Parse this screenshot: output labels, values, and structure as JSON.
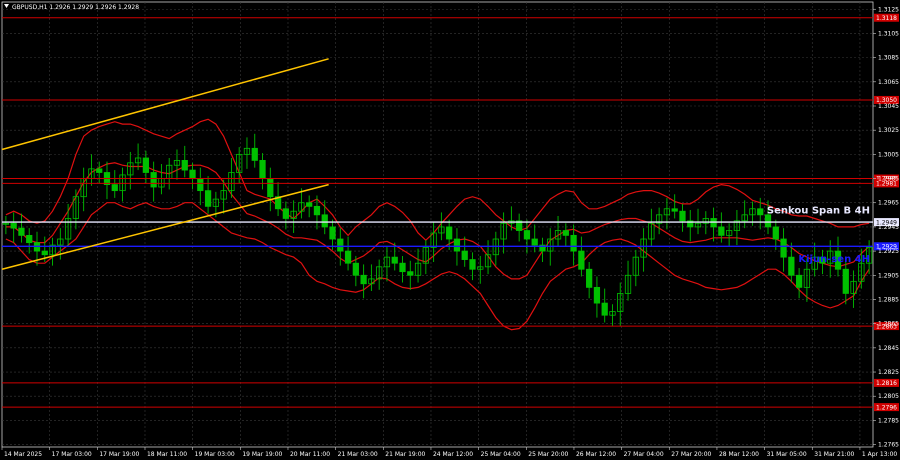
{
  "header": {
    "symbol_info": "GBPUSD,H1  1.2926 1.2929 1.2926 1.2928"
  },
  "colors": {
    "background": "#000000",
    "grid": "#3a3a3a",
    "candle": "#00c000",
    "level_red": "#d10000",
    "senkou": "#e8e8ff",
    "kijun": "#1a1aff",
    "channel": "#ffc400",
    "ichimoku": "#e01010"
  },
  "chart_data": {
    "type": "line",
    "title": "",
    "symbol": "GBPUSD",
    "timeframe": "H1",
    "ylim": [
      1.2763,
      1.3131
    ],
    "y_ticks": [
      "1.3125",
      "1.3105",
      "1.3085",
      "1.3065",
      "1.3045",
      "1.3025",
      "1.3005",
      "1.2985",
      "1.2965",
      "1.2945",
      "1.2925",
      "1.2905",
      "1.2885",
      "1.2865",
      "1.2845",
      "1.2825",
      "1.2805",
      "1.2785",
      "1.2765"
    ],
    "x_ticks": [
      "14 Mar 2025",
      "17 Mar 03:00",
      "17 Mar 19:00",
      "18 Mar 11:00",
      "19 Mar 03:00",
      "19 Mar 19:00",
      "20 Mar 11:00",
      "21 Mar 03:00",
      "21 Mar 19:00",
      "24 Mar 12:00",
      "25 Mar 04:00",
      "25 Mar 20:00",
      "26 Mar 12:00",
      "27 Mar 04:00",
      "27 Mar 20:00",
      "28 Mar 12:00",
      "31 Mar 05:00",
      "31 Mar 21:00",
      "1 Apr 13:00"
    ],
    "levels": [
      {
        "value": 1.3118,
        "label": "1.3118",
        "kind": "red"
      },
      {
        "value": 1.305,
        "label": "1.3050",
        "kind": "red"
      },
      {
        "value": 1.2985,
        "label": "1.2985",
        "kind": "red"
      },
      {
        "value": 1.2981,
        "label": "1.2981",
        "kind": "red"
      },
      {
        "value": 1.2949,
        "label": "1.2949",
        "kind": "senkou"
      },
      {
        "value": 1.2929,
        "label": "1.2929",
        "kind": "kijun"
      },
      {
        "value": 1.2863,
        "label": "1.2863",
        "kind": "red"
      },
      {
        "value": 1.2816,
        "label": "1.2816",
        "kind": "red"
      },
      {
        "value": 1.2796,
        "label": "1.2796",
        "kind": "red"
      }
    ],
    "annotations": [
      {
        "text": "Senkou Span B 4H",
        "value": 1.2956,
        "color": "#e8e8ff"
      },
      {
        "text": "Kijun-sen 4H",
        "value": 1.2916,
        "color": "#1a1aff"
      }
    ],
    "channel_lines": [
      {
        "x0": 0,
        "y0": 1.3009,
        "x1": 0.375,
        "y1": 1.3084
      },
      {
        "x0": 0,
        "y0": 1.291,
        "x1": 0.375,
        "y1": 1.298
      }
    ],
    "price": [
      1.2948,
      1.2944,
      1.2938,
      1.2932,
      1.2925,
      1.2922,
      1.293,
      1.2935,
      1.2952,
      1.297,
      1.2985,
      1.2993,
      1.299,
      1.298,
      1.2975,
      1.2988,
      1.2998,
      1.3002,
      1.299,
      1.2978,
      1.2985,
      1.2996,
      1.3,
      1.2992,
      1.2985,
      1.2975,
      1.2962,
      1.2968,
      1.2975,
      1.299,
      1.3005,
      1.301,
      1.3,
      1.2985,
      1.297,
      1.296,
      1.2952,
      1.2958,
      1.2965,
      1.2962,
      1.2955,
      1.2945,
      1.2935,
      1.2925,
      1.2915,
      1.2905,
      1.2898,
      1.2902,
      1.2912,
      1.292,
      1.2915,
      1.2908,
      1.2905,
      1.2915,
      1.2928,
      1.294,
      1.2945,
      1.2935,
      1.2925,
      1.2918,
      1.291,
      1.2912,
      1.2922,
      1.2935,
      1.2948,
      1.295,
      1.2942,
      1.2935,
      1.293,
      1.2925,
      1.2935,
      1.2942,
      1.2938,
      1.2925,
      1.291,
      1.2895,
      1.2882,
      1.2872,
      1.2875,
      1.289,
      1.2905,
      1.292,
      1.2935,
      1.2948,
      1.2955,
      1.296,
      1.2958,
      1.295,
      1.2945,
      1.2948,
      1.2952,
      1.2945,
      1.2938,
      1.2942,
      1.295,
      1.2955,
      1.296,
      1.2955,
      1.2945,
      1.2935,
      1.292,
      1.2905,
      1.2895,
      1.291,
      1.292,
      1.2915,
      1.2925,
      1.291,
      1.289,
      1.29,
      1.2915,
      1.2928
    ],
    "ichimoku_upper": [
      1.2955,
      1.2958,
      1.2955,
      1.295,
      1.2948,
      1.295,
      1.2958,
      1.297,
      1.2985,
      1.3005,
      1.302,
      1.3025,
      1.3028,
      1.303,
      1.3032,
      1.303,
      1.303,
      1.3028,
      1.3025,
      1.3022,
      1.302,
      1.3018,
      1.3022,
      1.3025,
      1.3028,
      1.3032,
      1.3034,
      1.303,
      1.302,
      1.3005,
      1.299,
      1.2975,
      1.2972,
      1.297,
      1.2968,
      1.2962,
      1.2956,
      1.2952,
      1.2958,
      1.2965,
      1.2968,
      1.2962,
      1.2955,
      1.2945,
      1.2938,
      1.2945,
      1.295,
      1.2955,
      1.2962,
      1.2965,
      1.2962,
      1.2957,
      1.295,
      1.294,
      1.2934,
      1.294,
      1.2948,
      1.2955,
      1.2962,
      1.2968,
      1.297,
      1.2968,
      1.2962,
      1.2955,
      1.295,
      1.2945,
      1.2942,
      1.2944,
      1.2952,
      1.296,
      1.2968,
      1.2972,
      1.2975,
      1.2974,
      1.2965,
      1.296,
      1.296,
      1.2962,
      1.2965,
      1.2968,
      1.2972,
      1.2974,
      1.2975,
      1.2975,
      1.2973,
      1.297,
      1.2966,
      1.2964,
      1.2964,
      1.2968,
      1.2974,
      1.2978,
      1.298,
      1.2979,
      1.2976,
      1.2972,
      1.2967,
      1.2965,
      1.2963,
      1.296,
      1.2958,
      1.2955,
      1.2954,
      1.2954,
      1.2952,
      1.295,
      1.2948,
      1.2945,
      1.2945,
      1.2945,
      1.2947,
      1.2948
    ],
    "ichimoku_lower": [
      1.2935,
      1.2932,
      1.2925,
      1.2918,
      1.2915,
      1.2915,
      1.292,
      1.2925,
      1.293,
      1.2935,
      1.2945,
      1.2955,
      1.296,
      1.2965,
      1.2965,
      1.2962,
      1.296,
      1.2963,
      1.2965,
      1.2962,
      1.296,
      1.296,
      1.2962,
      1.2965,
      1.2965,
      1.296,
      1.2955,
      1.295,
      1.2945,
      1.294,
      1.2938,
      1.2936,
      1.2935,
      1.2932,
      1.2928,
      1.2925,
      1.2922,
      1.292,
      1.2915,
      1.2905,
      1.29,
      1.2898,
      1.2895,
      1.2893,
      1.2892,
      1.2891,
      1.2893,
      1.2898,
      1.2903,
      1.2902,
      1.2898,
      1.2895,
      1.2894,
      1.2895,
      1.2898,
      1.2902,
      1.2906,
      1.2908,
      1.2906,
      1.2902,
      1.2896,
      1.289,
      1.288,
      1.287,
      1.2863,
      1.286,
      1.2861,
      1.2867,
      1.2878,
      1.289,
      1.29,
      1.2905,
      1.291,
      1.2912,
      1.2915,
      1.2922,
      1.2928,
      1.2932,
      1.2934,
      1.2935,
      1.2933,
      1.293,
      1.2925,
      1.292,
      1.2915,
      1.291,
      1.2905,
      1.2902,
      1.29,
      1.2898,
      1.2895,
      1.2894,
      1.2893,
      1.2894,
      1.2895,
      1.2898,
      1.2902,
      1.2906,
      1.291,
      1.291,
      1.2906,
      1.29,
      1.2893,
      1.2887,
      1.2883,
      1.288,
      1.2878,
      1.288,
      1.2884,
      1.2888,
      1.29,
      1.291
    ],
    "ichimoku_mid": [
      1.2945,
      1.2945,
      1.294,
      1.2934,
      1.2932,
      1.2932,
      1.2938,
      1.2948,
      1.2958,
      1.297,
      1.2982,
      1.299,
      1.2994,
      1.2997,
      1.2998,
      1.2996,
      1.2995,
      1.2995,
      1.2995,
      1.2992,
      1.299,
      1.2989,
      1.2992,
      1.2995,
      1.2996,
      1.2996,
      1.2994,
      1.299,
      1.2982,
      1.2972,
      1.2964,
      1.2956,
      1.2954,
      1.2951,
      1.2948,
      1.2944,
      1.2939,
      1.2936,
      1.2936,
      1.2935,
      1.2934,
      1.293,
      1.2925,
      1.2919,
      1.2915,
      1.2918,
      1.2921,
      1.2926,
      1.2932,
      1.2933,
      1.293,
      1.2926,
      1.2922,
      1.2918,
      1.2916,
      1.2921,
      1.2927,
      1.2931,
      1.2934,
      1.2935,
      1.2933,
      1.2929,
      1.2921,
      1.2912,
      1.2906,
      1.2902,
      1.2902,
      1.2905,
      1.2915,
      1.2925,
      1.2934,
      1.2938,
      1.2942,
      1.2943,
      1.294,
      1.2941,
      1.2944,
      1.2947,
      1.2949,
      1.2951,
      1.2952,
      1.2952,
      1.295,
      1.2948,
      1.2944,
      1.294,
      1.2936,
      1.2933,
      1.2932,
      1.2933,
      1.2934,
      1.2936,
      1.2936,
      1.2936,
      1.2936,
      1.2935,
      1.2934,
      1.2935,
      1.2936,
      1.2935,
      1.2932,
      1.2928,
      1.2923,
      1.292,
      1.2917,
      1.2915,
      1.2913,
      1.2912,
      1.2914,
      1.2916,
      1.2923,
      1.2929
    ]
  }
}
